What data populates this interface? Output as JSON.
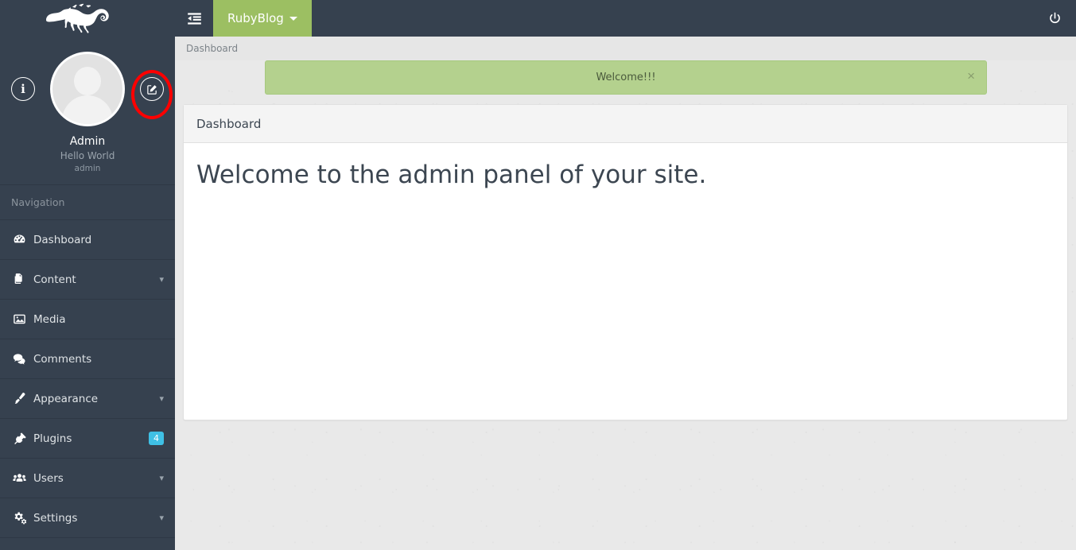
{
  "brand": {
    "logo_icon": "chameleon-logo",
    "name": "RubyBlog"
  },
  "topbar": {
    "sidebar_toggle_icon": "indent-list-icon",
    "logout_icon": "power-off-icon",
    "dropdown_caret_icon": "caret-down-icon"
  },
  "profile": {
    "info_icon": "info-circle-icon",
    "edit_icon": "edit-pencil-square-icon",
    "avatar_icon": "user-avatar-placeholder",
    "name": "Admin",
    "description": "Hello World",
    "role": "admin"
  },
  "annotation": {
    "shape": "red-ellipse-highlight",
    "color": "#ff0000",
    "target": "edit-profile-button"
  },
  "sidebar": {
    "section_label": "Navigation",
    "items": [
      {
        "label": "Dashboard",
        "icon": "tachometer-icon",
        "expandable": false,
        "badge": null,
        "active": false
      },
      {
        "label": "Content",
        "icon": "copy-files-icon",
        "expandable": true,
        "badge": null,
        "active": false
      },
      {
        "label": "Media",
        "icon": "image-icon",
        "expandable": false,
        "badge": null,
        "active": false
      },
      {
        "label": "Comments",
        "icon": "comments-icon",
        "expandable": false,
        "badge": null,
        "active": false
      },
      {
        "label": "Appearance",
        "icon": "paintbrush-icon",
        "expandable": true,
        "badge": null,
        "active": false
      },
      {
        "label": "Plugins",
        "icon": "plug-icon",
        "expandable": false,
        "badge": "4",
        "active": false
      },
      {
        "label": "Users",
        "icon": "users-group-icon",
        "expandable": true,
        "badge": null,
        "active": false
      },
      {
        "label": "Settings",
        "icon": "cogs-icon",
        "expandable": true,
        "badge": null,
        "active": false
      }
    ]
  },
  "breadcrumb": {
    "current": "Dashboard"
  },
  "alert": {
    "message": "Welcome!!!",
    "close_label": "×",
    "type": "success",
    "color": "#b4d18e"
  },
  "panel": {
    "heading": "Dashboard",
    "body_text": "Welcome to the admin panel of your site."
  },
  "colors": {
    "sidebar": "#36414f",
    "header": "#36414f",
    "brand_green": "#9cbf62",
    "alert_green": "#b4d18e",
    "badge_blue": "#3fc0e5",
    "page_background": "#e9e9e9",
    "annotation_red": "#ff0000"
  }
}
